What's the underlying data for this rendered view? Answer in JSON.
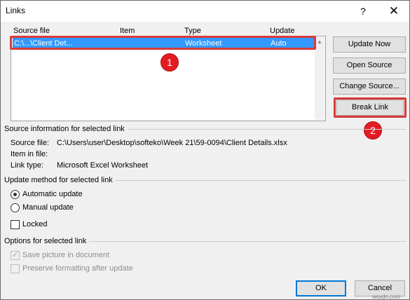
{
  "window": {
    "title": "Links",
    "help_label": "?",
    "close_label": "✕"
  },
  "links_list": {
    "columns": [
      "Source file",
      "Item",
      "Type",
      "Update"
    ],
    "rows": [
      {
        "source_file": "C:\\...\\Client Det...",
        "item": "",
        "type": "Worksheet",
        "update": "Auto",
        "selected": true
      }
    ]
  },
  "buttons": {
    "update_now": "Update Now",
    "open_source": "Open Source",
    "change_source": "Change Source...",
    "break_link": "Break Link",
    "ok": "OK",
    "cancel": "Cancel"
  },
  "source_info": {
    "section_title": "Source information for selected link",
    "source_file_label": "Source file:",
    "source_file_value": "C:\\Users\\user\\Desktop\\softeko\\Week 21\\59-0094\\Client Details.xlsx",
    "item_label": "Item in file:",
    "item_value": "",
    "link_type_label": "Link type:",
    "link_type_value": "Microsoft Excel Worksheet"
  },
  "update_method": {
    "section_title": "Update method for selected link",
    "automatic_label": "Automatic update",
    "manual_label": "Manual update",
    "selected": "automatic",
    "locked_label": "Locked",
    "locked": false
  },
  "options": {
    "section_title": "Options for selected link",
    "save_picture_label": "Save picture in document",
    "save_picture_checked": true,
    "preserve_formatting_label": "Preserve formatting after update",
    "preserve_formatting_checked": false
  },
  "annotations": {
    "badge_1": "1",
    "badge_2": "2",
    "highlight_color": "#d93a3a"
  },
  "watermark": "wsxdn.com",
  "colors": {
    "selection": "#3399ff",
    "dialog_bg": "#f0f0f0",
    "primary_border": "#0078d7"
  }
}
